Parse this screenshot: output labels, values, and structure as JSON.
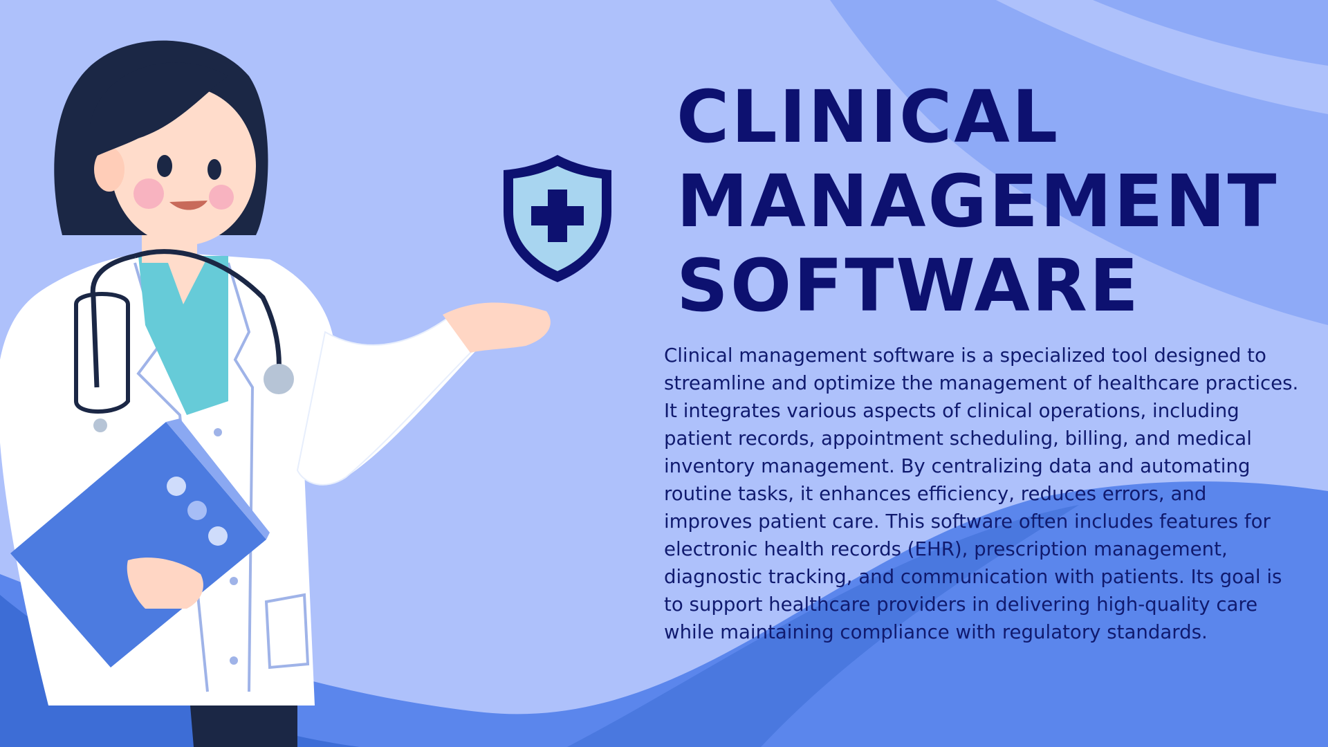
{
  "slide": {
    "title_lines": [
      "CLINICAL",
      "MANAGEMENT",
      "SOFTWARE"
    ],
    "description": "Clinical management software is a specialized tool designed to streamline and optimize the management of healthcare practices. It integrates various aspects of clinical operations, including patient records, appointment scheduling, billing, and medical inventory management. By centralizing data and automating routine tasks, it enhances efficiency, reduces errors, and improves patient care. This software often includes features for electronic health records (EHR), prescription management, diagnostic tracking, and communication with patients. Its goal is to support healthcare providers in delivering high-quality care while maintaining compliance with regulatory standards."
  },
  "icons": {
    "shield": "shield-medical-cross-icon",
    "illustration": "doctor-illustration"
  },
  "colors": {
    "background": "#aec1fb",
    "title": "#0d1170",
    "text": "#101a6e",
    "wave_light": "#8eaaf7",
    "wave_mid": "#5b86ec",
    "wave_dark": "#3d6dd6",
    "shield_outline": "#0d1170",
    "shield_fill": "#a8d5f0"
  }
}
